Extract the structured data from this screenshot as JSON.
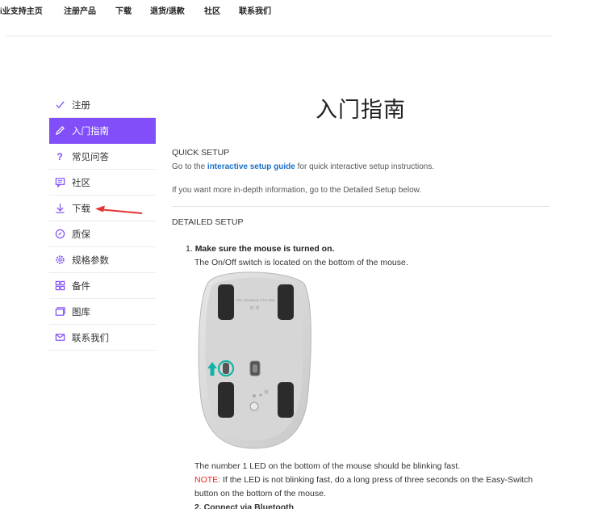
{
  "topnav": {
    "items": [
      "i业支持主页",
      "注册产品",
      "下载",
      "退货/退款",
      "社区",
      "联系我们"
    ]
  },
  "sidebar": {
    "items": [
      {
        "label": "注册",
        "icon": "check-icon"
      },
      {
        "label": "入门指南",
        "icon": "pencil-icon",
        "active": true
      },
      {
        "label": "常见问答",
        "icon": "question-icon"
      },
      {
        "label": "社区",
        "icon": "chat-icon"
      },
      {
        "label": "下载",
        "icon": "download-icon"
      },
      {
        "label": "质保",
        "icon": "warranty-icon"
      },
      {
        "label": "规格参数",
        "icon": "settings-icon"
      },
      {
        "label": "备件",
        "icon": "grid-icon"
      },
      {
        "label": "图库",
        "icon": "gallery-icon"
      },
      {
        "label": "联系我们",
        "icon": "mail-icon"
      }
    ],
    "active_color": "#814efa"
  },
  "main": {
    "title": "入门指南",
    "quick_setup": {
      "heading": "QUICK SETUP",
      "line1_prefix": "Go to the",
      "line1_link": "interactive setup guide",
      "line1_suffix": "for quick interactive setup instructions.",
      "line2": "If you want more in-depth information, go to the Detailed Setup below."
    },
    "detailed_setup": {
      "heading": "DETAILED SETUP",
      "step1_number": "1.",
      "step1_title": "Make sure the mouse is turned on.",
      "step1_text": "The On/Off switch is located on the bottom of the mouse.",
      "mouse_label": "MX Anywhere 3 for Mac",
      "after_image_text": "The number 1 LED on the bottom of the mouse should be blinking fast.",
      "note_label": "NOTE:",
      "note_text": "If the LED is not blinking fast, do a long press of three seconds on the Easy-Switch",
      "note_text2": "button on the bottom of the mouse.",
      "step2_title": "2. Connect via Bluetooth"
    }
  },
  "colors": {
    "accent": "#814efa",
    "link": "#1a6fc8",
    "note": "#e22222",
    "annotation_arrow": "#e33333"
  }
}
